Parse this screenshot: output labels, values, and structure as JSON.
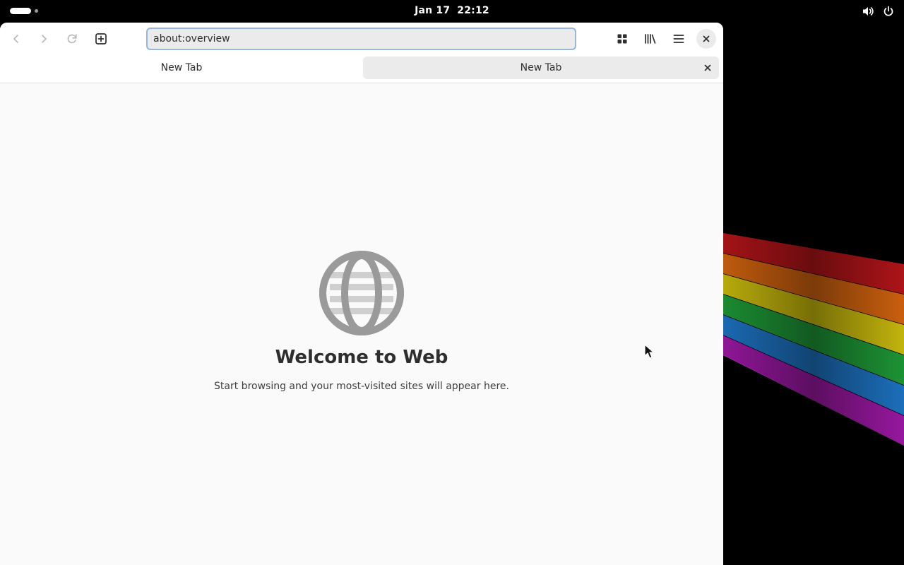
{
  "topbar": {
    "date": "Jan 17",
    "time": "22:12",
    "icons": [
      "activities-indicator",
      "volume-icon",
      "power-icon"
    ]
  },
  "browser": {
    "toolbar": {
      "back_icon": "chevron-left-icon",
      "forward_icon": "chevron-right-icon",
      "reload_icon": "reload-icon",
      "new_tab_icon": "new-tab-icon",
      "overview_icon": "grid-icon",
      "library_icon": "library-icon",
      "menu_icon": "hamburger-menu-icon",
      "close_icon": "close-icon"
    },
    "url": {
      "value": "about:overview"
    },
    "tabs": [
      {
        "label": "New Tab",
        "active": false
      },
      {
        "label": "New Tab",
        "active": true
      }
    ],
    "content": {
      "title": "Welcome to Web",
      "subtitle": "Start browsing and your most-visited sites will appear here.",
      "icon": "globe-icon"
    }
  },
  "colors": {
    "accent_focus": "#97b6d8",
    "window_bg": "#fafafa",
    "desktop_bg": "#000000",
    "rainbow": [
      "#c0161b",
      "#e06a10",
      "#d8c80e",
      "#20a33a",
      "#1f7bd0",
      "#a71ab0"
    ]
  }
}
